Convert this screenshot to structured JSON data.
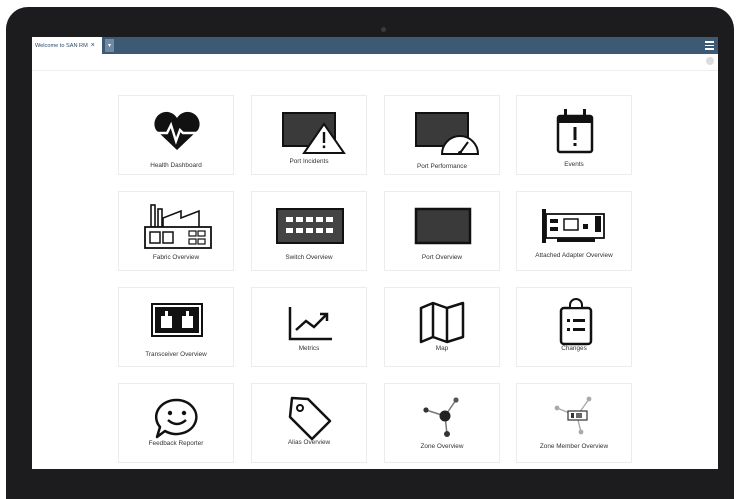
{
  "tab": {
    "label": "Welcome to SAN RM",
    "close": "×",
    "dropdown": "▾"
  },
  "tiles": [
    {
      "label": "Health Dashboard",
      "icon": "heart-pulse-icon"
    },
    {
      "label": "Port Incidents",
      "icon": "warning-monitor-icon"
    },
    {
      "label": "Port Performance",
      "icon": "speedometer-monitor-icon"
    },
    {
      "label": "Events",
      "icon": "calendar-alert-icon"
    },
    {
      "label": "Fabric Overview",
      "icon": "factory-icon"
    },
    {
      "label": "Switch Overview",
      "icon": "switch-icon"
    },
    {
      "label": "Port Overview",
      "icon": "port-icon"
    },
    {
      "label": "Attached Adapter Overview",
      "icon": "adapter-card-icon"
    },
    {
      "label": "Transceiver Overview",
      "icon": "transceiver-icon"
    },
    {
      "label": "Metrics",
      "icon": "trend-chart-icon"
    },
    {
      "label": "Map",
      "icon": "map-icon"
    },
    {
      "label": "Changes",
      "icon": "clipboard-list-icon"
    },
    {
      "label": "Feedback Reporter",
      "icon": "smiley-chat-icon"
    },
    {
      "label": "Alias Overview",
      "icon": "tag-icon"
    },
    {
      "label": "Zone Overview",
      "icon": "zone-nodes-icon"
    },
    {
      "label": "Zone Member Overview",
      "icon": "zone-member-icon"
    }
  ]
}
